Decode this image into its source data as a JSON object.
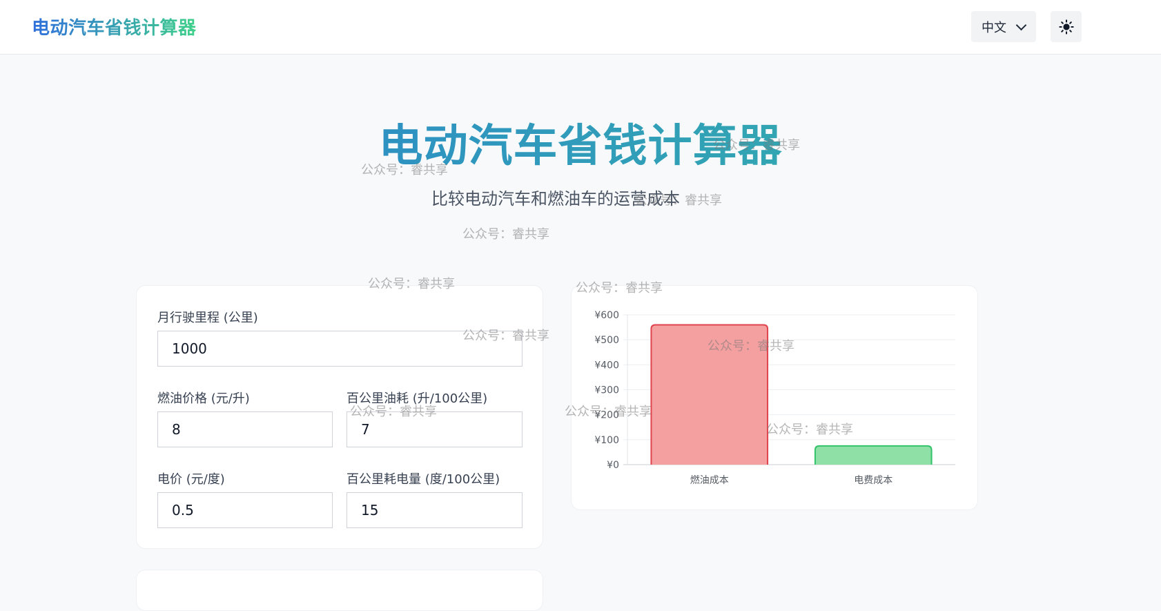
{
  "header": {
    "brand": "电动汽车省钱计算器",
    "language": "中文",
    "theme_icon": "sun-icon"
  },
  "hero": {
    "title": "电动汽车省钱计算器",
    "subtitle": "比较电动汽车和燃油车的运营成本"
  },
  "form": {
    "monthly_distance": {
      "label": "月行驶里程 (公里)",
      "value": "1000"
    },
    "fuel_price": {
      "label": "燃油价格 (元/升)",
      "value": "8"
    },
    "fuel_consumption": {
      "label": "百公里油耗 (升/100公里)",
      "value": "7"
    },
    "electricity_price": {
      "label": "电价 (元/度)",
      "value": "0.5"
    },
    "power_consumption": {
      "label": "百公里耗电量 (度/100公里)",
      "value": "15"
    }
  },
  "chart_data": {
    "type": "bar",
    "categories": [
      "燃油成本",
      "电费成本"
    ],
    "values": [
      560,
      75
    ],
    "ylim": [
      0,
      600
    ],
    "yticks": [
      "¥0",
      "¥100",
      "¥200",
      "¥300",
      "¥400",
      "¥500",
      "¥600"
    ],
    "colors": [
      "#f4a0a1",
      "#8ee0a6"
    ],
    "border_colors": [
      "#e0434d",
      "#34c26a"
    ],
    "grid": true
  },
  "watermark": "公众号：睿共享"
}
